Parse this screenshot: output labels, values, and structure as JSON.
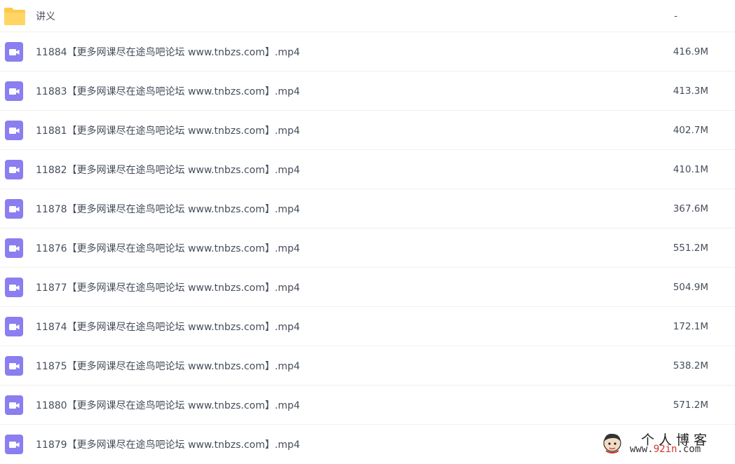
{
  "colors": {
    "folder": "#ffc94d",
    "video": "#8a7ef0",
    "text": "#454d5a",
    "divider": "#f0f0f2",
    "watermark_accent": "#d0342c"
  },
  "folder": {
    "name": "讲义",
    "size": "-",
    "icon": "folder-icon"
  },
  "files": [
    {
      "name": "11884【更多网课尽在途鸟吧论坛 www.tnbzs.com】.mp4",
      "size": "416.9M",
      "icon": "video-file-icon"
    },
    {
      "name": "11883【更多网课尽在途鸟吧论坛 www.tnbzs.com】.mp4",
      "size": "413.3M",
      "icon": "video-file-icon"
    },
    {
      "name": "11881【更多网课尽在途鸟吧论坛 www.tnbzs.com】.mp4",
      "size": "402.7M",
      "icon": "video-file-icon"
    },
    {
      "name": "11882【更多网课尽在途鸟吧论坛 www.tnbzs.com】.mp4",
      "size": "410.1M",
      "icon": "video-file-icon"
    },
    {
      "name": "11878【更多网课尽在途鸟吧论坛 www.tnbzs.com】.mp4",
      "size": "367.6M",
      "icon": "video-file-icon"
    },
    {
      "name": "11876【更多网课尽在途鸟吧论坛 www.tnbzs.com】.mp4",
      "size": "551.2M",
      "icon": "video-file-icon"
    },
    {
      "name": "11877【更多网课尽在途鸟吧论坛 www.tnbzs.com】.mp4",
      "size": "504.9M",
      "icon": "video-file-icon"
    },
    {
      "name": "11874【更多网课尽在途鸟吧论坛 www.tnbzs.com】.mp4",
      "size": "172.1M",
      "icon": "video-file-icon"
    },
    {
      "name": "11875【更多网课尽在途鸟吧论坛 www.tnbzs.com】.mp4",
      "size": "538.2M",
      "icon": "video-file-icon"
    },
    {
      "name": "11880【更多网课尽在途鸟吧论坛 www.tnbzs.com】.mp4",
      "size": "571.2M",
      "icon": "video-file-icon"
    },
    {
      "name": "11879【更多网课尽在途鸟吧论坛 www.tnbzs.com】.mp4",
      "size": "",
      "icon": "video-file-icon"
    }
  ],
  "watermark": {
    "title": "个人博客",
    "url_prefix": "www.",
    "url_accent": "92in",
    "url_suffix": ".com"
  }
}
